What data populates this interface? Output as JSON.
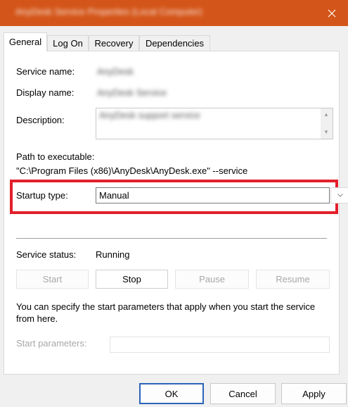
{
  "window": {
    "title": "AnyDesk Service Properties (Local Computer)"
  },
  "tabs": [
    {
      "label": "General"
    },
    {
      "label": "Log On"
    },
    {
      "label": "Recovery"
    },
    {
      "label": "Dependencies"
    }
  ],
  "general": {
    "service_name_label": "Service name:",
    "service_name_value": "AnyDesk",
    "display_name_label": "Display name:",
    "display_name_value": "AnyDesk Service",
    "description_label": "Description:",
    "description_value": "AnyDesk support service",
    "path_label": "Path to executable:",
    "path_value": "\"C:\\Program Files (x86)\\AnyDesk\\AnyDesk.exe\" --service",
    "startup_type_label": "Startup type:",
    "startup_type_value": "Manual",
    "service_status_label": "Service status:",
    "service_status_value": "Running",
    "buttons": {
      "start": "Start",
      "stop": "Stop",
      "pause": "Pause",
      "resume": "Resume"
    },
    "info_text": "You can specify the start parameters that apply when you start the service from here.",
    "start_params_label": "Start parameters:",
    "start_params_value": ""
  },
  "footer": {
    "ok": "OK",
    "cancel": "Cancel",
    "apply": "Apply"
  },
  "colors": {
    "titlebar": "#d45519",
    "highlight": "#e2202a",
    "default_button_border": "#2a64b8"
  },
  "icons": {
    "close": "close-icon",
    "dropdown": "chevron-down-icon",
    "scroll_up": "scroll-up-arrow-icon",
    "scroll_down": "scroll-down-arrow-icon"
  }
}
